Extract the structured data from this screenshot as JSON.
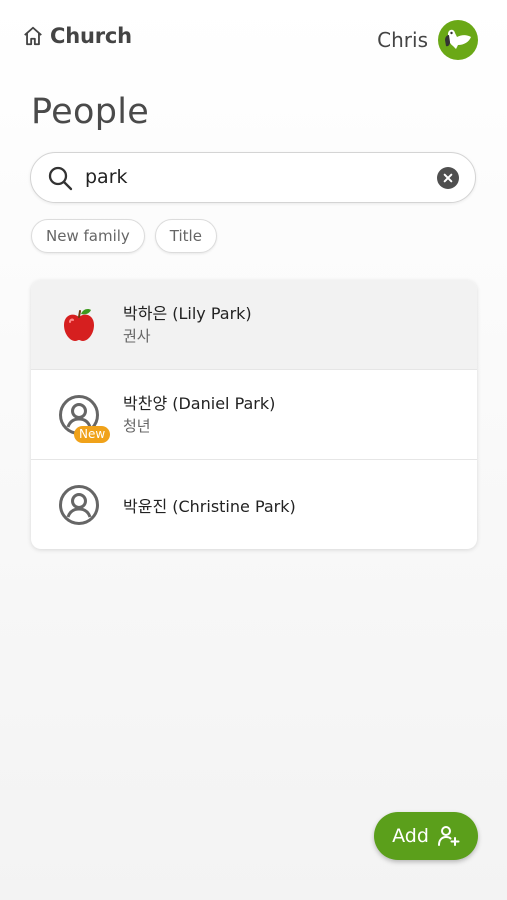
{
  "header": {
    "brand": "Church",
    "user_name": "Chris",
    "accent": "#6aa816"
  },
  "page": {
    "title": "People"
  },
  "search": {
    "value": "park",
    "placeholder": ""
  },
  "filters": [
    {
      "label": "New family"
    },
    {
      "label": "Title"
    }
  ],
  "people": [
    {
      "name": "박하은 (Lily Park)",
      "subtitle": "권사",
      "icon": "apple-icon",
      "badge": ""
    },
    {
      "name": "박찬양 (Daniel Park)",
      "subtitle": "청년",
      "icon": "person-circle-icon",
      "badge": "New"
    },
    {
      "name": "박윤진 (Christine Park)",
      "subtitle": "",
      "icon": "person-circle-icon",
      "badge": ""
    }
  ],
  "add_button": {
    "label": "Add"
  },
  "colors": {
    "primary": "#5b9f1b",
    "badge": "#f0a21a"
  }
}
